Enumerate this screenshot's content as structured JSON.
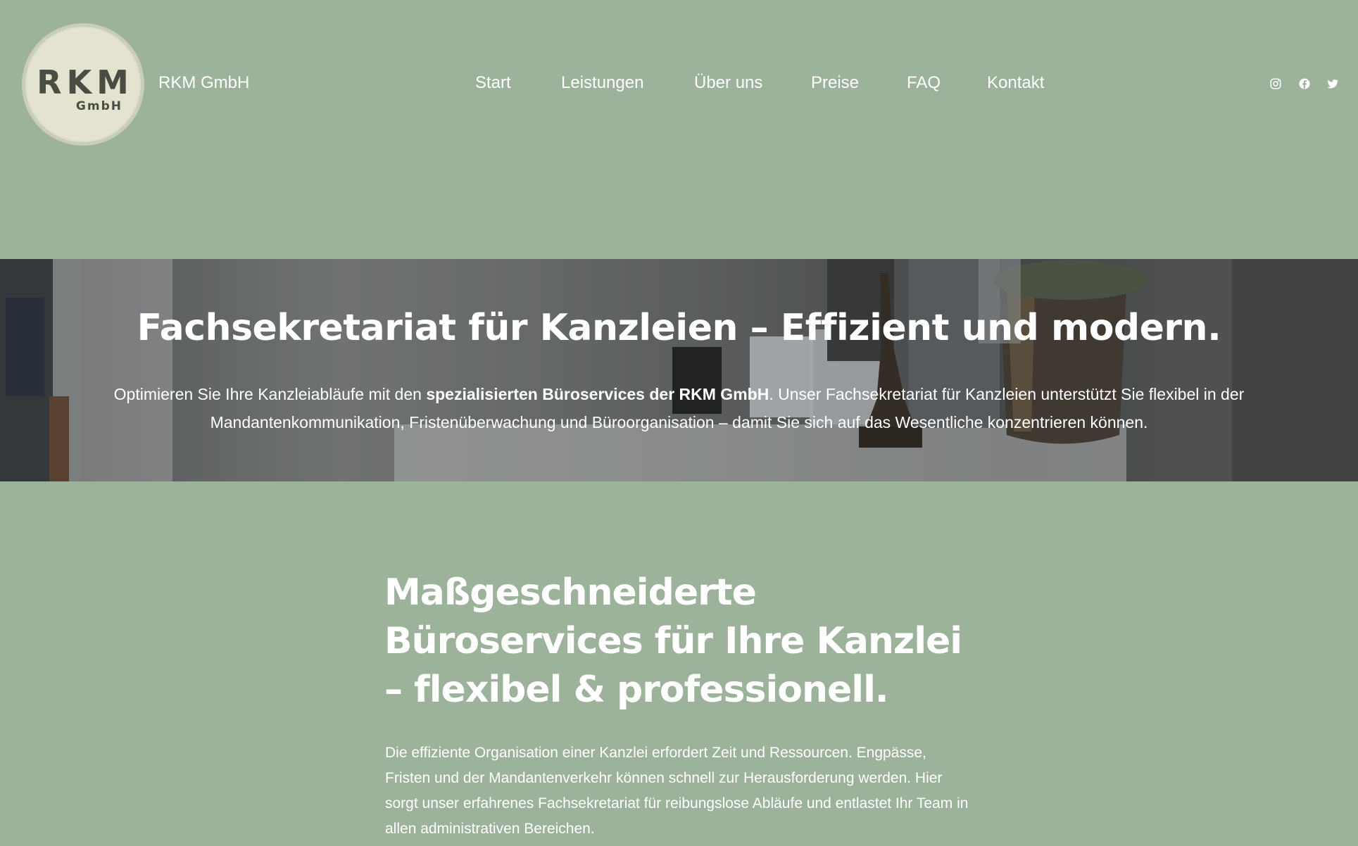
{
  "header": {
    "logo": {
      "main": "RKM",
      "sub": "GmbH"
    },
    "site_name": "RKM GmbH",
    "nav": [
      "Start",
      "Leistungen",
      "Über uns",
      "Preise",
      "FAQ",
      "Kontakt"
    ],
    "social": [
      "instagram-icon",
      "facebook-icon",
      "twitter-icon"
    ]
  },
  "hero": {
    "title": "Fachsekretariat für Kanzleien – Effizient und modern.",
    "text_before": "Optimieren Sie Ihre Kanzleiabläufe mit den ",
    "text_bold": "spezialisierten Büroservices der RKM GmbH",
    "text_after": ". Unser Fachsekretariat für Kanzleien unterstützt Sie flexibel in der Mandantenkommunikation, Fristenüberwachung und Büroorganisation – damit Sie sich auf das Wesentliche konzentrieren können."
  },
  "section": {
    "title": "Maßgeschneiderte Büroservices für Ihre Kanzlei – flexibel & professionell.",
    "text": "Die effiziente Organisation einer Kanzlei erfordert Zeit und Ressourcen. Engpässe, Fristen und der Mandantenverkehr können schnell zur Herausforderung werden. Hier sorgt unser erfahrenes Fachsekretariat für reibungslose Abläufe und entlastet Ihr Team in allen administrativen Bereichen."
  },
  "colors": {
    "background": "#9db29a",
    "logo_bg": "#e4e3cf",
    "logo_text": "#4a4d44",
    "text": "#ffffff"
  }
}
